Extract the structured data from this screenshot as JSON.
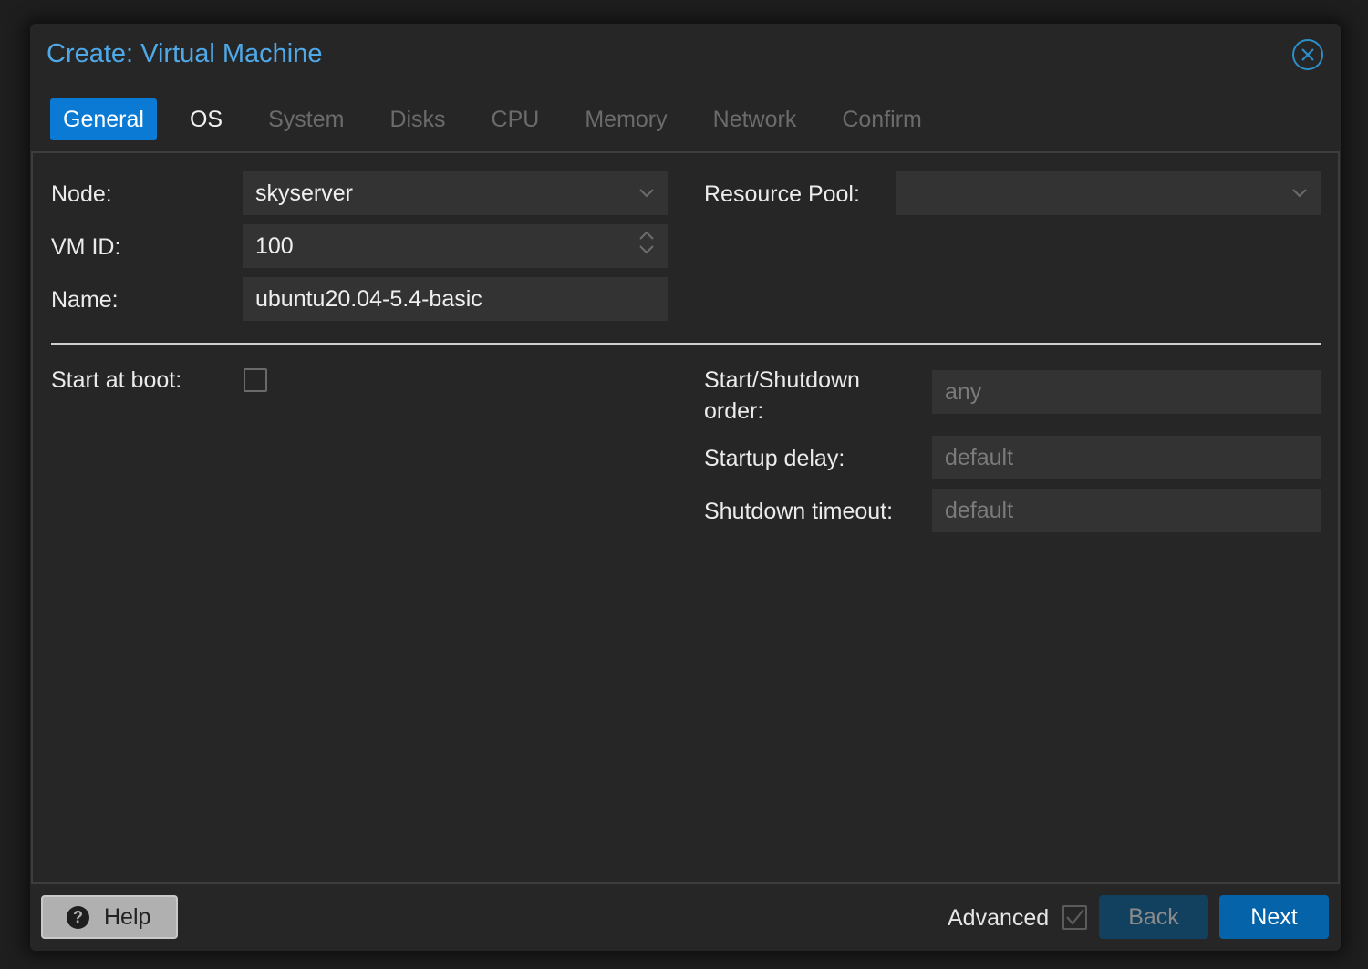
{
  "dialog": {
    "title": "Create: Virtual Machine",
    "close_icon": "close-circle-icon"
  },
  "tabs": [
    {
      "label": "General",
      "state": "active"
    },
    {
      "label": "OS",
      "state": "enabled"
    },
    {
      "label": "System",
      "state": "disabled"
    },
    {
      "label": "Disks",
      "state": "disabled"
    },
    {
      "label": "CPU",
      "state": "disabled"
    },
    {
      "label": "Memory",
      "state": "disabled"
    },
    {
      "label": "Network",
      "state": "disabled"
    },
    {
      "label": "Confirm",
      "state": "disabled"
    }
  ],
  "general": {
    "node": {
      "label": "Node:",
      "value": "skyserver",
      "icon": "chevron-down-icon"
    },
    "vmid": {
      "label": "VM ID:",
      "value": "100",
      "icon": "spinner-arrows-icon"
    },
    "name": {
      "label": "Name:",
      "value": "ubuntu20.04-5.4-basic"
    },
    "resource_pool": {
      "label": "Resource Pool:",
      "value": "",
      "icon": "chevron-down-icon"
    },
    "start_at_boot": {
      "label": "Start at boot:",
      "checked": false
    },
    "start_shutdown_order": {
      "label_line1": "Start/Shutdown",
      "label_line2": "order:",
      "placeholder": "any"
    },
    "startup_delay": {
      "label": "Startup delay:",
      "placeholder": "default"
    },
    "shutdown_timeout": {
      "label": "Shutdown timeout:",
      "placeholder": "default"
    }
  },
  "footer": {
    "help_label": "Help",
    "help_icon": "question-circle-icon",
    "advanced_label": "Advanced",
    "advanced_checked": true,
    "back_label": "Back",
    "next_label": "Next"
  },
  "colors": {
    "accent": "#0a7ad5",
    "title": "#4fa9e8",
    "next_button": "#0563a9",
    "back_button": "#12405f"
  }
}
